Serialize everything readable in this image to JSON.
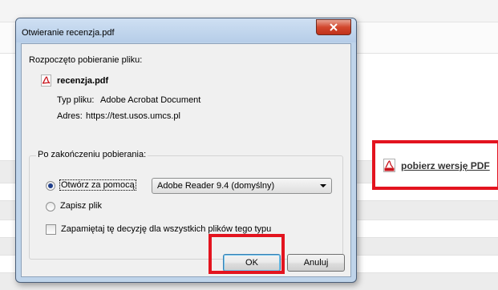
{
  "dialog": {
    "title": "Otwieranie recenzja.pdf",
    "intro": "Rozpoczęto pobieranie pliku:",
    "file_name": "recenzja.pdf",
    "type_label": "Typ pliku:",
    "type_value": "Adobe Acrobat Document",
    "address_label": "Adres:",
    "address_value": "https://test.usos.umcs.pl",
    "group_title": "Po zakończeniu pobierania:",
    "open_with_label": "Otwórz za pomocą",
    "open_with_selected": true,
    "application": "Adobe Reader 9.4 (domyślny)",
    "save_label": "Zapisz plik",
    "save_selected": false,
    "remember_label": "Zapamiętaj tę decyzję dla wszystkich plików tego typu",
    "remember_checked": false,
    "ok_label": "OK",
    "cancel_label": "Anuluj"
  },
  "page": {
    "pdf_link_label": "pobierz wersję PDF"
  },
  "colors": {
    "highlight": "#e3141f",
    "pdf_icon": "#c8141c",
    "dialog_frame": "#bfd4ea"
  }
}
